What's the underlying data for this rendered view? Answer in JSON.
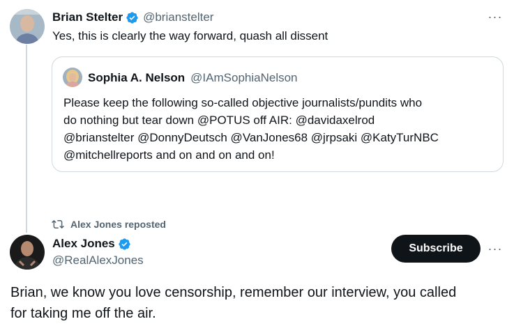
{
  "colors": {
    "text_primary": "#0f1419",
    "text_secondary": "#536471",
    "verified_blue": "#1d9bf0",
    "border": "#cfd9de",
    "button_bg": "#0f1419"
  },
  "tweet1": {
    "author_name": "Brian Stelter",
    "handle": "@brianstelter",
    "text": "Yes, this is clearly the way forward, quash all dissent",
    "more_icon": "more-horizontal-icon",
    "more_label": "···"
  },
  "quote": {
    "author_name": "Sophia A. Nelson",
    "handle": "@IAmSophiaNelson",
    "text_lines": [
      "Please keep the following so-called objective journalists/pundits who",
      "do nothing but tear down @POTUS off AIR: @davidaxelrod",
      "@brianstelter @DonnyDeutsch @VanJones68 @jrpsaki @KatyTurNBC",
      "@mitchellreports and on and on and on!"
    ]
  },
  "repost": {
    "icon": "repost-icon",
    "label": "Alex Jones reposted"
  },
  "tweet2": {
    "author_name": "Alex Jones",
    "handle": "@RealAlexJones",
    "subscribe_label": "Subscribe",
    "more_label": "···",
    "text_lines": [
      "Brian, we know you love censorship, remember our interview, you called",
      "for taking me off the air."
    ]
  }
}
